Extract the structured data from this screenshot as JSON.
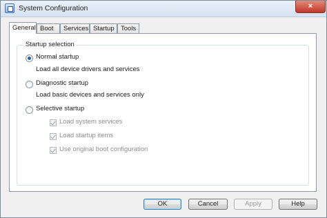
{
  "window": {
    "title": "System Configuration",
    "close_glyph": "×"
  },
  "tabs": [
    {
      "label": "General",
      "active": true
    },
    {
      "label": "Boot",
      "active": false
    },
    {
      "label": "Services",
      "active": false
    },
    {
      "label": "Startup",
      "active": false
    },
    {
      "label": "Tools",
      "active": false
    }
  ],
  "startup": {
    "group_label": "Startup selection",
    "normal": {
      "label": "Normal startup",
      "description": "Load all device drivers and services",
      "selected": true
    },
    "diagnostic": {
      "label": "Diagnostic startup",
      "description": "Load basic devices and services only",
      "selected": false
    },
    "selective": {
      "label": "Selective startup",
      "selected": false,
      "options": [
        {
          "label": "Load system services",
          "checked": true,
          "enabled": false
        },
        {
          "label": "Load startup items",
          "checked": true,
          "enabled": false
        },
        {
          "label": "Use original boot configuration",
          "checked": true,
          "enabled": false
        }
      ]
    }
  },
  "buttons": {
    "ok": "OK",
    "cancel": "Cancel",
    "apply": "Apply",
    "help": "Help"
  }
}
